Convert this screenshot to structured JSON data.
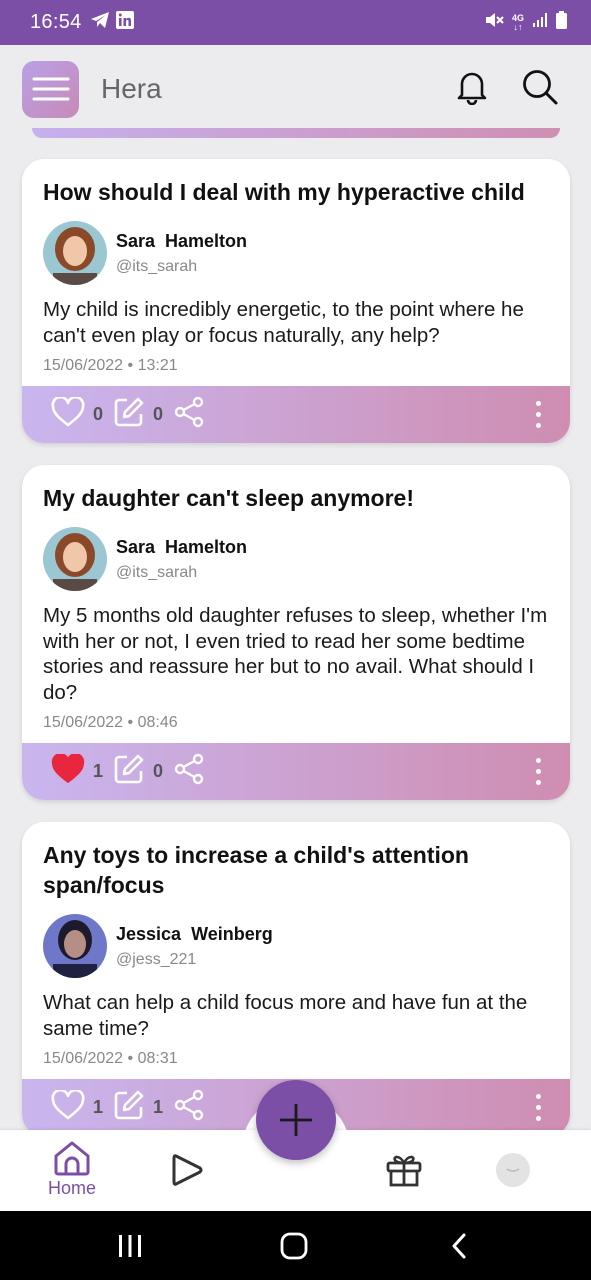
{
  "status_bar": {
    "time": "16:54",
    "left_icons": [
      "telegram-icon",
      "linkedin-icon"
    ],
    "right_icons": [
      "mute-icon",
      "network-4g-icon",
      "signal-icon",
      "battery-icon"
    ],
    "network_label": "4G"
  },
  "app_bar": {
    "title": "Hera",
    "icons": [
      "menu-icon",
      "bell-icon",
      "search-icon"
    ]
  },
  "posts": [
    {
      "title": "How should I deal with my hyperactive child",
      "author_name": "Sara  Hamelton",
      "author_handle": "@its_sarah",
      "content": "My child is incredibly energetic, to the point where he can't even play or focus naturally, any help?",
      "timestamp": "15/06/2022 • 13:21",
      "likes": "0",
      "liked": false,
      "comments": "0"
    },
    {
      "title": "My daughter can't sleep anymore!",
      "author_name": "Sara  Hamelton",
      "author_handle": "@its_sarah",
      "content": "My 5 months old daughter refuses to sleep, whether I'm with her or not, I even tried to read her some bedtime stories and reassure her but to no avail. What should I do?",
      "timestamp": "15/06/2022 • 08:46",
      "likes": "1",
      "liked": true,
      "comments": "0"
    },
    {
      "title": "Any toys to increase a child's attention span/focus",
      "author_name": "Jessica  Weinberg",
      "author_handle": "@jess_221",
      "content": "What can help a child focus more and have fun at the same time?",
      "timestamp": "15/06/2022 • 08:31",
      "likes": "1",
      "liked": false,
      "comments": "1"
    }
  ],
  "bottom_nav": {
    "home_label": "Home",
    "items": [
      "home-icon",
      "play-icon",
      "add-post-icon",
      "gift-icon",
      "profile-avatar"
    ]
  },
  "colors": {
    "primary": "#7b4fa6",
    "accent_gradient_start": "#c9b6ef",
    "accent_gradient_end": "#cf8db1",
    "like_red": "#e8263d"
  }
}
